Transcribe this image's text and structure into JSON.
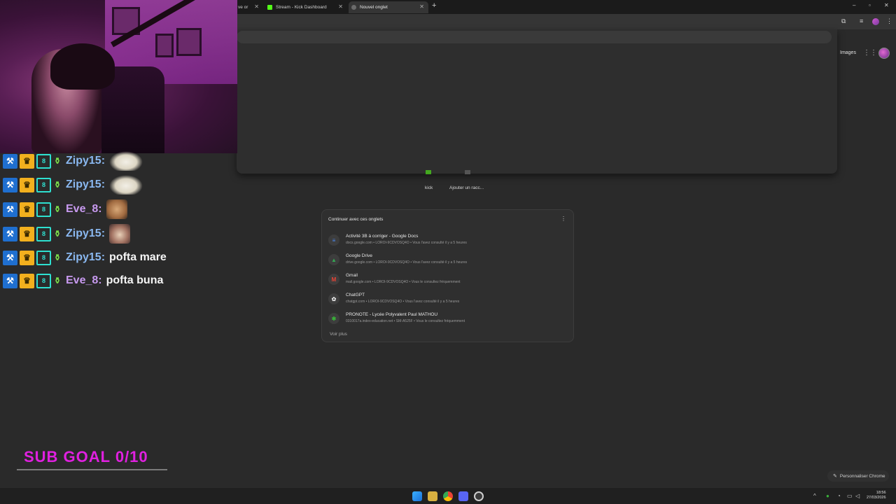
{
  "browser": {
    "tabs": [
      {
        "label": "ve or",
        "active": false
      },
      {
        "label": "Stream - Kick Dashboard",
        "active": false
      },
      {
        "label": "Nouvel onglet",
        "active": true
      }
    ],
    "new_tab_symbol": "+",
    "window_controls": [
      "–",
      "▫",
      "✕"
    ]
  },
  "header": {
    "images_label": "Images",
    "apps_icon": "apps-grid-icon",
    "account_icon": "avatar"
  },
  "shortcuts": [
    {
      "label": "kick",
      "icon": "kick-icon",
      "color": "#53fc18"
    },
    {
      "label": "Ajouter un racc...",
      "icon": "add-shortcut-icon",
      "color": "#cfcfcf"
    }
  ],
  "continue_card": {
    "title": "Continuer avec ces onglets",
    "menu_icon": "more-vert-icon",
    "items": [
      {
        "title": "Activité 3B à corriger - Google Docs",
        "subtitle": "docs.google.com • LOROI-9CDVOSQ4O • Vous l'avez consulté il y a 5 heures",
        "icon": "docs-icon",
        "glyph": "≡",
        "color": "#4a8af4"
      },
      {
        "title": "Google Drive",
        "subtitle": "drive.google.com • LOROI-9CDVOSQ4O • Vous l'avez consulté il y a 5 heures",
        "icon": "drive-icon",
        "glyph": "▲",
        "color": "#34a853"
      },
      {
        "title": "Gmail",
        "subtitle": "mail.google.com • LOROI-9CDVOSQ4O • Vous le consultez fréquemment",
        "icon": "gmail-icon",
        "glyph": "M",
        "color": "#ea4335"
      },
      {
        "title": "ChatGPT",
        "subtitle": "chatgpt.com • LOROI-9CDVOSQ4O • Vous l'avez consulté il y a 5 heures",
        "icon": "chatgpt-icon",
        "glyph": "✿",
        "color": "#e8e8e8"
      },
      {
        "title": "PRONOTE - Lycée Polyvalent Paul MATHOU",
        "subtitle": "0310017a.index-education.net • SM-A525F • Vous le consultez fréquemment",
        "icon": "pronote-icon",
        "glyph": "✱",
        "color": "#3ab03a"
      }
    ],
    "see_more": "Voir plus"
  },
  "customize_chrome": "Personnaliser Chrome",
  "stream_overlay": {
    "chat": [
      {
        "username": "Zipy15:",
        "color": "blue",
        "message": "",
        "emote": "bird"
      },
      {
        "username": "Zipy15:",
        "color": "blue",
        "message": "",
        "emote": "bird"
      },
      {
        "username": "Eve_8:",
        "color": "purple",
        "message": "",
        "emote": "cat"
      },
      {
        "username": "Zipy15:",
        "color": "blue",
        "message": "",
        "emote": "cat2"
      },
      {
        "username": "Zipy15:",
        "color": "blue",
        "message": "pofta mare",
        "emote": ""
      },
      {
        "username": "Eve_8:",
        "color": "purple",
        "message": "pofta buna",
        "emote": ""
      }
    ],
    "sub_goal": "SUB GOAL 0/10",
    "sub_goal_progress": 0
  },
  "taskbar": {
    "time": "18:56",
    "date": "27/03/2026",
    "apps": [
      "windows-start-icon",
      "file-explorer-icon",
      "chrome-icon",
      "discord-icon",
      "obs-icon"
    ]
  },
  "colors": {
    "kick_green": "#53fc18",
    "sub_goal_magenta": "#e020e0",
    "chrome_dark": "#2a2a2a"
  }
}
